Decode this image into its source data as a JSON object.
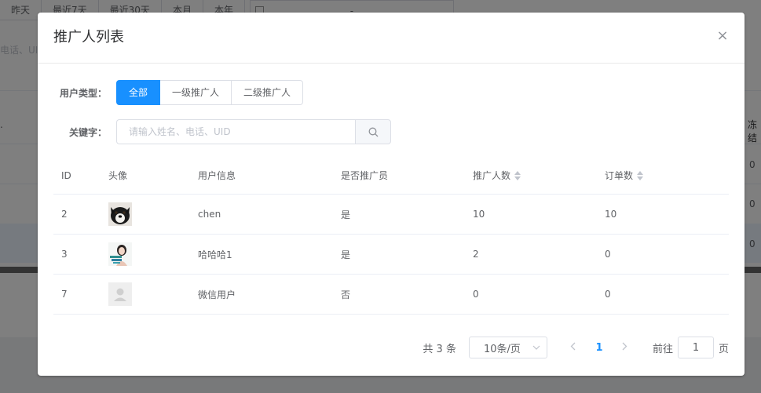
{
  "background": {
    "date_buttons": [
      "昨天",
      "最近7天",
      "最近30天",
      "本月",
      "本年"
    ],
    "date_separator": "-",
    "search_placeholder_fragment": "电话、UI",
    "side_label": "冻结",
    "side_values": [
      "0",
      "0",
      "0"
    ]
  },
  "dialog": {
    "title": "推广人列表",
    "close_glyph": "×",
    "user_type_label": "用户类型：",
    "user_types": [
      "全部",
      "一级推广人",
      "二级推广人"
    ],
    "active_user_type": "全部",
    "keyword_label": "关键字：",
    "keyword_placeholder": "请输入姓名、电话、UID",
    "keyword_value": ""
  },
  "table": {
    "columns": [
      "ID",
      "头像",
      "用户信息",
      "是否推广员",
      "推广人数",
      "订单数"
    ],
    "sortable": [
      false,
      false,
      false,
      false,
      true,
      true
    ],
    "rows": [
      {
        "id": "2",
        "avatar": "dog-avatar",
        "name": "chen",
        "is_promoter": "是",
        "promote_count": "10",
        "order_count": "10"
      },
      {
        "id": "3",
        "avatar": "girl-avatar",
        "name": "哈哈哈1",
        "is_promoter": "是",
        "promote_count": "2",
        "order_count": "0"
      },
      {
        "id": "7",
        "avatar": "default-user-avatar",
        "name": "微信用户",
        "is_promoter": "否",
        "promote_count": "0",
        "order_count": "0"
      }
    ]
  },
  "pagination": {
    "total": "共 3 条",
    "page_size": "10条/页",
    "current_page": "1",
    "goto_prefix": "前往",
    "goto_value": "1",
    "goto_suffix": "页"
  },
  "colors": {
    "primary": "#1890ff",
    "border": "#dcdfe6",
    "text": "#606266"
  }
}
